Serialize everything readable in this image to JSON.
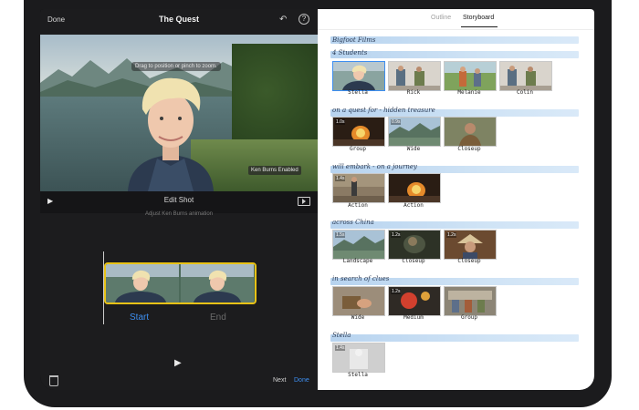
{
  "app": {
    "project_title": "The Quest",
    "done_label": "Done",
    "help_label": "?",
    "undo_label": "↶"
  },
  "preview": {
    "hint": "Drag to position or pinch to zoom.",
    "ken_burns_badge": "Ken Burns Enabled"
  },
  "editor": {
    "title": "Edit Shot",
    "subtitle": "Adjust Ken Burns animation",
    "start_label": "Start",
    "end_label": "End",
    "next_label": "Next",
    "done_label": "Done"
  },
  "tabs": [
    {
      "label": "Outline",
      "active": false
    },
    {
      "label": "Storyboard",
      "active": true
    }
  ],
  "storyboard": {
    "sections": [
      {
        "heading": "Bigfoot Films",
        "subheading": "4 Students",
        "clips": [
          {
            "label": "Stella",
            "duration": "",
            "scene": "stella",
            "selected": true
          },
          {
            "label": "Rick",
            "duration": "",
            "scene": "people"
          },
          {
            "label": "Melanie",
            "duration": "",
            "scene": "melanie"
          },
          {
            "label": "Colin",
            "duration": "",
            "scene": "people"
          }
        ]
      },
      {
        "heading": "on a quest for - hidden treasure",
        "clips": [
          {
            "label": "Group",
            "duration": "1.0s",
            "scene": "fire"
          },
          {
            "label": "Wide",
            "duration": "0.9s",
            "scene": "landscape"
          },
          {
            "label": "Closeup",
            "duration": "",
            "scene": "closeup"
          }
        ]
      },
      {
        "heading": "will embark - on a journey",
        "clips": [
          {
            "label": "Action",
            "duration": "1.4s",
            "scene": "action"
          },
          {
            "label": "Action",
            "duration": "",
            "scene": "fire"
          }
        ]
      },
      {
        "heading": "across China",
        "clips": [
          {
            "label": "Landscape",
            "duration": "1.5s",
            "scene": "landscape"
          },
          {
            "label": "Closeup",
            "duration": "1.2s",
            "scene": "dark"
          },
          {
            "label": "Closeup",
            "duration": "1.2s",
            "scene": "hat"
          }
        ]
      },
      {
        "heading": "in search of clues",
        "clips": [
          {
            "label": "Wide",
            "duration": "",
            "scene": "hands"
          },
          {
            "label": "Medium",
            "duration": "1.2s",
            "scene": "lantern"
          },
          {
            "label": "Group",
            "duration": "",
            "scene": "market"
          }
        ]
      },
      {
        "heading": "Stella",
        "clips": [
          {
            "label": "Stella",
            "duration": "1.4s",
            "scene": "grey"
          }
        ]
      }
    ]
  },
  "colors": {
    "accent": "#3d8ef0",
    "selection": "#e8c216",
    "band": "#b7d3ef"
  },
  "icons": {
    "play": "▶",
    "undo": "↶"
  }
}
